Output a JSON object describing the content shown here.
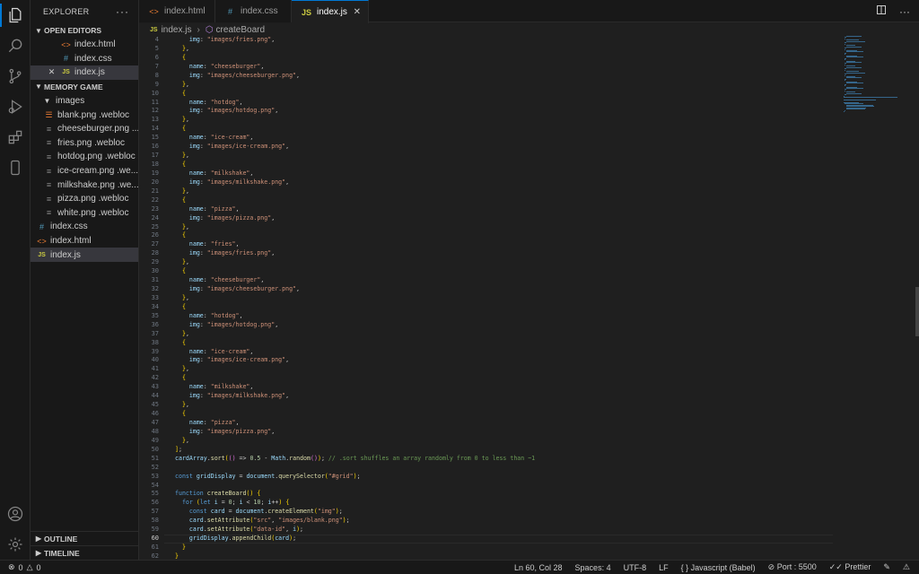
{
  "explorer": {
    "title": "EXPLORER",
    "more": "···",
    "open_editors_label": "OPEN EDITORS",
    "open_editors": [
      {
        "name": "index.html",
        "type": "html"
      },
      {
        "name": "index.css",
        "type": "css"
      },
      {
        "name": "index.js",
        "type": "js",
        "selected": true
      }
    ],
    "folder_label": "MEMORY GAME",
    "subfolder": "images",
    "image_files": [
      {
        "name": "blank.png .webloc",
        "type": "rss"
      },
      {
        "name": "cheeseburger.png ....",
        "type": "lines"
      },
      {
        "name": "fries.png .webloc",
        "type": "lines"
      },
      {
        "name": "hotdog.png .webloc",
        "type": "lines"
      },
      {
        "name": "ice-cream.png .we...",
        "type": "lines"
      },
      {
        "name": "milkshake.png .we...",
        "type": "lines"
      },
      {
        "name": "pizza.png .webloc",
        "type": "lines"
      },
      {
        "name": "white.png .webloc",
        "type": "lines"
      }
    ],
    "root_files": [
      {
        "name": "index.css",
        "type": "css"
      },
      {
        "name": "index.html",
        "type": "html"
      },
      {
        "name": "index.js",
        "type": "js",
        "selected": true
      }
    ],
    "outline_label": "OUTLINE",
    "timeline_label": "TIMELINE"
  },
  "tabs": [
    {
      "label": "index.html",
      "type": "html"
    },
    {
      "label": "index.css",
      "type": "css"
    },
    {
      "label": "index.js",
      "type": "js",
      "active": true
    }
  ],
  "breadcrumb": {
    "file": "index.js",
    "symbol": "createBoard"
  },
  "editor": {
    "lines": [
      {
        "n": "4",
        "code": "    img: \"images/fries.png\","
      },
      {
        "n": "5",
        "code": "  },"
      },
      {
        "n": "6",
        "code": "  {"
      },
      {
        "n": "7",
        "code": "    name: \"cheeseburger\","
      },
      {
        "n": "8",
        "code": "    img: \"images/cheeseburger.png\","
      },
      {
        "n": "9",
        "code": "  },"
      },
      {
        "n": "10",
        "code": "  {"
      },
      {
        "n": "11",
        "code": "    name: \"hotdog\","
      },
      {
        "n": "12",
        "code": "    img: \"images/hotdog.png\","
      },
      {
        "n": "13",
        "code": "  },"
      },
      {
        "n": "14",
        "code": "  {"
      },
      {
        "n": "15",
        "code": "    name: \"ice-cream\","
      },
      {
        "n": "16",
        "code": "    img: \"images/ice-cream.png\","
      },
      {
        "n": "17",
        "code": "  },"
      },
      {
        "n": "18",
        "code": "  {"
      },
      {
        "n": "19",
        "code": "    name: \"milkshake\","
      },
      {
        "n": "20",
        "code": "    img: \"images/milkshake.png\","
      },
      {
        "n": "21",
        "code": "  },"
      },
      {
        "n": "22",
        "code": "  {"
      },
      {
        "n": "23",
        "code": "    name: \"pizza\","
      },
      {
        "n": "24",
        "code": "    img: \"images/pizza.png\","
      },
      {
        "n": "25",
        "code": "  },"
      },
      {
        "n": "26",
        "code": "  {"
      },
      {
        "n": "27",
        "code": "    name: \"fries\","
      },
      {
        "n": "28",
        "code": "    img: \"images/fries.png\","
      },
      {
        "n": "29",
        "code": "  },"
      },
      {
        "n": "30",
        "code": "  {"
      },
      {
        "n": "31",
        "code": "    name: \"cheeseburger\","
      },
      {
        "n": "32",
        "code": "    img: \"images/cheeseburger.png\","
      },
      {
        "n": "33",
        "code": "  },"
      },
      {
        "n": "34",
        "code": "  {"
      },
      {
        "n": "35",
        "code": "    name: \"hotdog\","
      },
      {
        "n": "36",
        "code": "    img: \"images/hotdog.png\","
      },
      {
        "n": "37",
        "code": "  },"
      },
      {
        "n": "38",
        "code": "  {"
      },
      {
        "n": "39",
        "code": "    name: \"ice-cream\","
      },
      {
        "n": "40",
        "code": "    img: \"images/ice-cream.png\","
      },
      {
        "n": "41",
        "code": "  },"
      },
      {
        "n": "42",
        "code": "  {"
      },
      {
        "n": "43",
        "code": "    name: \"milkshake\","
      },
      {
        "n": "44",
        "code": "    img: \"images/milkshake.png\","
      },
      {
        "n": "45",
        "code": "  },"
      },
      {
        "n": "46",
        "code": "  {"
      },
      {
        "n": "47",
        "code": "    name: \"pizza\","
      },
      {
        "n": "48",
        "code": "    img: \"images/pizza.png\","
      },
      {
        "n": "49",
        "code": "  },"
      },
      {
        "n": "50",
        "code": "];"
      },
      {
        "n": "51",
        "code": "cardArray.sort(() => 0.5 - Math.random()); // .sort shuffles an array randomly from 0 to less than ~1"
      },
      {
        "n": "52",
        "code": ""
      },
      {
        "n": "53",
        "code": "const gridDisplay = document.querySelector(\"#grid\");"
      },
      {
        "n": "54",
        "code": ""
      },
      {
        "n": "55",
        "code": "function createBoard() {"
      },
      {
        "n": "56",
        "code": "  for (let i = 0; i < 10; i++) {"
      },
      {
        "n": "57",
        "code": "    const card = document.createElement(\"img\");"
      },
      {
        "n": "58",
        "code": "    card.setAttribute(\"src\", \"images/blank.png\");"
      },
      {
        "n": "59",
        "code": "    card.setAttribute(\"data-id\", i);"
      },
      {
        "n": "60",
        "code": "    gridDisplay.appendChild(card);",
        "current": true
      },
      {
        "n": "61",
        "code": "  }"
      },
      {
        "n": "62",
        "code": "}"
      }
    ]
  },
  "status": {
    "errors": "0",
    "warnings": "0",
    "position": "Ln 60, Col 28",
    "spaces": "Spaces: 4",
    "encoding": "UTF-8",
    "eol": "LF",
    "language": "Javascript (Babel)",
    "port": "Port : 5500",
    "prettier": "Prettier"
  },
  "colors": {
    "accent": "#0078d4",
    "background": "#1f1f1f",
    "sidebar": "#181818",
    "keyword": "#569cd6",
    "string": "#ce9178",
    "property": "#9cdcfe",
    "function": "#dcdcaa",
    "comment": "#6a9955"
  }
}
